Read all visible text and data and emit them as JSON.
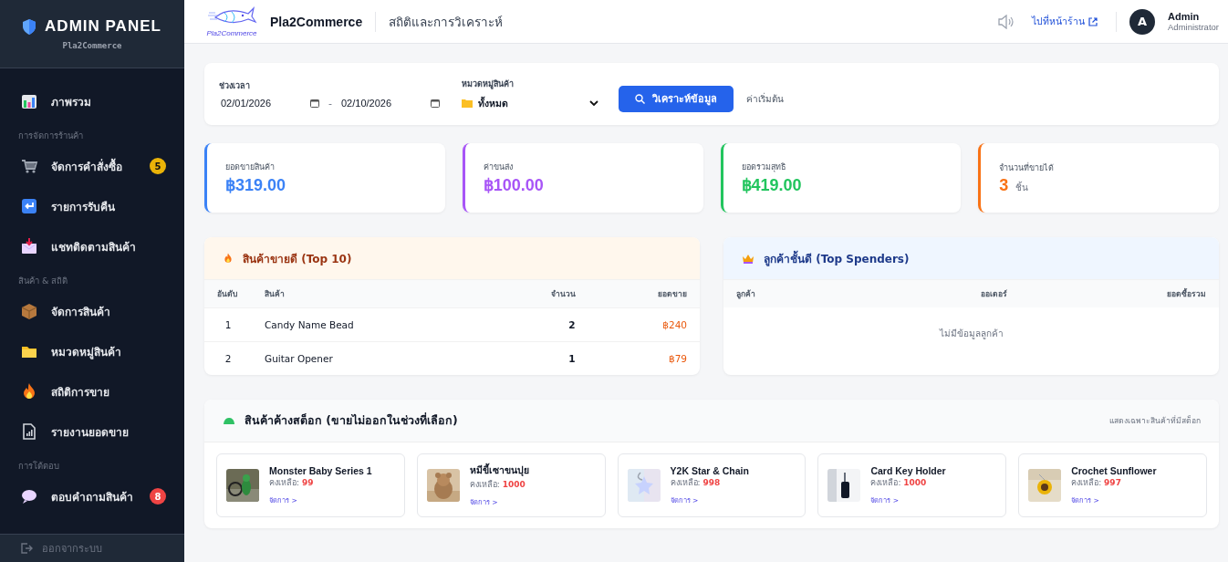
{
  "sidebar": {
    "title": "ADMIN PANEL",
    "subtitle": "Pla2Commerce",
    "sections": [
      {
        "items": [
          {
            "label": "ภาพรวม"
          }
        ]
      },
      {
        "heading": "การจัดการร้านค้า",
        "items": [
          {
            "label": "จัดการคำสั่งซื้อ",
            "badge": "5",
            "color": "#eab308"
          },
          {
            "label": "รายการรับคืน"
          },
          {
            "label": "แชทติดตามสินค้า"
          }
        ]
      },
      {
        "heading": "สินค้า & สถิติ",
        "items": [
          {
            "label": "จัดการสินค้า"
          },
          {
            "label": "หมวดหมู่สินค้า"
          },
          {
            "label": "สถิติการขาย"
          },
          {
            "label": "รายงานยอดขาย"
          }
        ]
      },
      {
        "heading": "การโต้ตอบ",
        "items": [
          {
            "label": "ตอบคำถามสินค้า",
            "badge": "8",
            "color": "#ef4444"
          }
        ]
      }
    ],
    "logout": "ออกจากระบบ"
  },
  "header": {
    "brand": "Pla2Commerce",
    "logo_caption": "Pla2Commerce",
    "page_title": "สถิติและการวิเคราะห์",
    "store_link": "ไปที่หน้าร้าน",
    "user": {
      "initial": "A",
      "name": "Admin",
      "role": "Administrator"
    }
  },
  "filters": {
    "date_label": "ช่วงเวลา",
    "date_from": "02/01/2026",
    "separator": "-",
    "date_to": "02/10/2026",
    "category_label": "หมวดหมู่สินค้า",
    "category_value": "ทั้งหมด",
    "analyze_button": "วิเคราะห์ข้อมูล",
    "reset_link": "ค่าเริ่มต้น"
  },
  "stats": [
    {
      "label": "ยอดขายสินค้า",
      "value": "฿319.00",
      "color": "#3b82f6"
    },
    {
      "label": "ค่าขนส่ง",
      "value": "฿100.00",
      "color": "#a855f7"
    },
    {
      "label": "ยอดรวมสุทธิ",
      "value": "฿419.00",
      "color": "#22c55e"
    },
    {
      "label": "จำนวนที่ขายได้",
      "value": "3",
      "unit": "ชิ้น",
      "color": "#f97316"
    }
  ],
  "top_products": {
    "title": "สินค้าขายดี (Top 10)",
    "columns": [
      "อันดับ",
      "สินค้า",
      "จำนวน",
      "ยอดขาย"
    ],
    "rows": [
      [
        "1",
        "Candy Name Bead",
        "2",
        "฿240"
      ],
      [
        "2",
        "Guitar Opener",
        "1",
        "฿79"
      ]
    ]
  },
  "top_customers": {
    "title": "ลูกค้าชั้นดี (Top Spenders)",
    "columns": [
      "ลูกค้า",
      "ออเดอร์",
      "ยอดซื้อรวม"
    ],
    "empty": "ไม่มีข้อมูลลูกค้า"
  },
  "dead_stock": {
    "title": "สินค้าค้างสต็อก (ขายไม่ออกในช่วงที่เลือก)",
    "note": "แสดงเฉพาะสินค้าที่มีสต็อก",
    "items": [
      {
        "name": "Monster Baby Series 1",
        "stock_label": "คงเหลือ:",
        "stock": "99",
        "action": "จัดการ >",
        "kind": "picture"
      },
      {
        "name": "หมีขี้เซาขนปุย",
        "stock_label": "คงเหลือ:",
        "stock": "1000",
        "action": "จัดการ >",
        "kind": "picture"
      },
      {
        "name": "Y2K Star & Chain",
        "stock_label": "คงเหลือ:",
        "stock": "998",
        "action": "จัดการ >",
        "kind": "picture"
      },
      {
        "name": "Card Key Holder",
        "stock_label": "คงเหลือ:",
        "stock": "1000",
        "action": "จัดการ >",
        "kind": "picture"
      },
      {
        "name": "Crochet Sunflower",
        "stock_label": "คงเหลือ:",
        "stock": "997",
        "action": "จัดการ >",
        "kind": "picture"
      }
    ]
  }
}
